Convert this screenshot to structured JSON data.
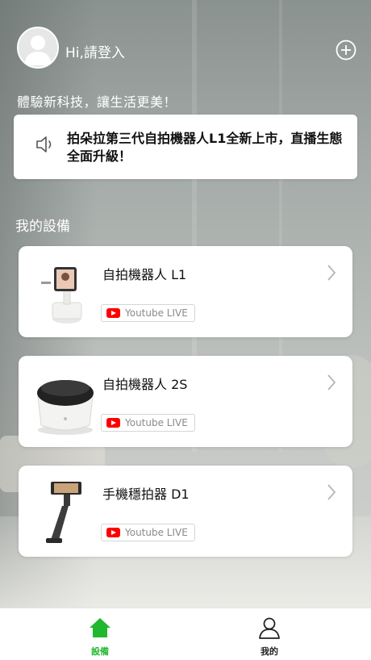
{
  "header": {
    "greeting": "Hi,請登入",
    "tagline": "體驗新科技，讓生活更美！"
  },
  "notice": {
    "text": "拍朵拉第三代自拍機器人L1全新上市，直播生態全面升級！"
  },
  "devices_section": {
    "title": "我的設備",
    "items": [
      {
        "name": "自拍機器人 L1",
        "badge": "Youtube LIVE"
      },
      {
        "name": "自拍機器人 2S",
        "badge": "Youtube LIVE"
      },
      {
        "name": "手機穩拍器 D1",
        "badge": "Youtube LIVE"
      }
    ]
  },
  "tabbar": {
    "tabs": [
      {
        "label": "設備",
        "active": true
      },
      {
        "label": "我的",
        "active": false
      }
    ]
  },
  "colors": {
    "accent_green": "#1fb82f",
    "youtube_red": "#ff0000"
  },
  "icons": [
    "avatar-icon",
    "add-icon",
    "speaker-icon",
    "chevron-right-icon",
    "youtube-icon",
    "home-icon",
    "person-icon"
  ]
}
